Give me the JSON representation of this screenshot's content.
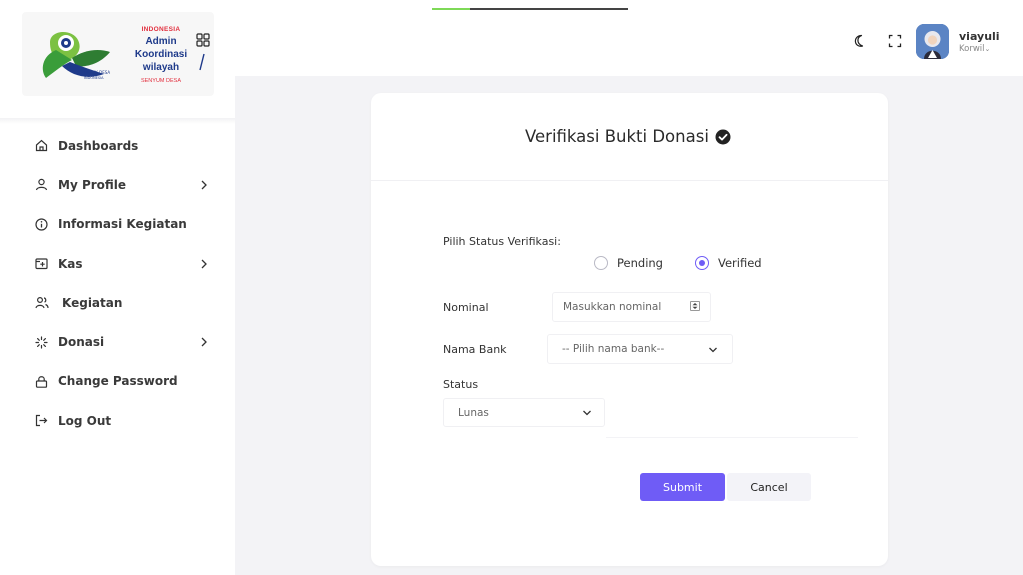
{
  "logo": {
    "line1": "INDONESIA",
    "line2": "Admin",
    "line3": "Koordinasi",
    "line4": "wilayah",
    "line5": "SENYUM DESA"
  },
  "sidebar": {
    "items": [
      {
        "label": "Dashboards",
        "icon": "home-icon",
        "has_chevron": false
      },
      {
        "label": "My Profile",
        "icon": "user-icon",
        "has_chevron": true
      },
      {
        "label": "Informasi Kegiatan",
        "icon": "info-icon",
        "has_chevron": false
      },
      {
        "label": "Kas",
        "icon": "wallet-plus-icon",
        "has_chevron": true
      },
      {
        "label": "Kegiatan",
        "icon": "users-icon",
        "has_chevron": false
      },
      {
        "label": "Donasi",
        "icon": "loader-icon",
        "has_chevron": true
      },
      {
        "label": "Change Password",
        "icon": "lock-icon",
        "has_chevron": false
      },
      {
        "label": "Log Out",
        "icon": "logout-icon",
        "has_chevron": false
      }
    ]
  },
  "header": {
    "user_name": "viayuli",
    "user_role": "Korwil",
    "icons": [
      "moon-icon",
      "fullscreen-icon"
    ]
  },
  "form": {
    "title": "Verifikasi Bukti Donasi",
    "status_label": "Pilih Status Verifikasi:",
    "radio_options": [
      {
        "label": "Pending",
        "checked": false
      },
      {
        "label": "Verified",
        "checked": true
      }
    ],
    "nominal_label": "Nominal",
    "nominal_placeholder": "Masukkan nominal",
    "bank_label": "Nama Bank",
    "bank_placeholder": "-- Pilih nama bank--",
    "status_field_label": "Status",
    "status_value": "Lunas",
    "submit_label": "Submit",
    "cancel_label": "Cancel"
  },
  "colors": {
    "accent": "#6f5cf6",
    "background": "#f3f3f6",
    "logo_red": "#e2303f",
    "logo_blue": "#1e3a8a",
    "logo_green": "#4caf50"
  }
}
